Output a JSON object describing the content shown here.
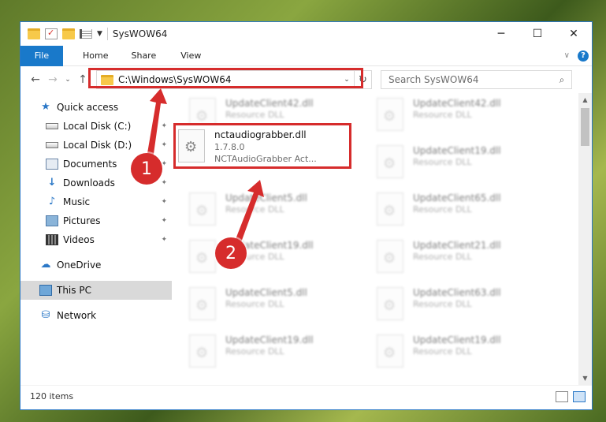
{
  "window": {
    "title": "SysWOW64",
    "minimize": "─",
    "maximize": "☐",
    "close": "✕"
  },
  "ribbon": {
    "tabs": [
      {
        "label": "File"
      },
      {
        "label": "Home"
      },
      {
        "label": "Share"
      },
      {
        "label": "View"
      }
    ],
    "collapse_icon": "chevron-down-icon",
    "help_label": "?"
  },
  "address": {
    "back": "←",
    "forward": "→",
    "recent": "⌄",
    "up": "↑",
    "path": "C:\\Windows\\SysWOW64",
    "dropdown": "⌄",
    "refresh": "↻"
  },
  "search": {
    "placeholder": "Search SysWOW64",
    "icon": "⌕"
  },
  "navpane": {
    "items": [
      {
        "label": "Quick access",
        "icon": "star-icon",
        "glyph": "★",
        "pinned": false
      },
      {
        "label": "Local Disk (C:)",
        "icon": "disk-icon",
        "pinned": true
      },
      {
        "label": "Local Disk (D:)",
        "icon": "disk-icon",
        "pinned": true
      },
      {
        "label": "Documents",
        "icon": "documents-icon",
        "pinned": true
      },
      {
        "label": "Downloads",
        "icon": "downloads-icon",
        "glyph": "↓",
        "pinned": true
      },
      {
        "label": "Music",
        "icon": "music-icon",
        "glyph": "♪",
        "pinned": true
      },
      {
        "label": "Pictures",
        "icon": "pictures-icon",
        "pinned": true
      },
      {
        "label": "Videos",
        "icon": "videos-icon",
        "pinned": true
      },
      {
        "label": "OneDrive",
        "icon": "cloud-icon",
        "glyph": "☁"
      },
      {
        "label": "This PC",
        "icon": "computer-icon"
      },
      {
        "label": "Network",
        "icon": "network-icon",
        "glyph": "⛁"
      }
    ],
    "pin_glyph": "📌"
  },
  "files": {
    "left": [
      {
        "name": "UpdateClient42.dll",
        "type": "Resource DLL"
      },
      {
        "name": "nctaudiograbber.dll",
        "version": "1.7.8.0",
        "type": "NCTAudioGrabber Act..."
      },
      {
        "name": "UpdateClient5.dll",
        "type": "Resource DLL"
      },
      {
        "name": "UpdateClient19.dll",
        "type": "Resource DLL"
      },
      {
        "name": "UpdateClient5.dll",
        "type": "Resource DLL"
      },
      {
        "name": "UpdateClient19.dll",
        "type": "Resource DLL"
      }
    ],
    "right": [
      {
        "name": "UpdateClient42.dll",
        "type": "Resource DLL"
      },
      {
        "name": "UpdateClient19.dll",
        "type": "Resource DLL"
      },
      {
        "name": "UpdateClient65.dll",
        "type": "Resource DLL"
      },
      {
        "name": "UpdateClient21.dll",
        "type": "Resource DLL"
      },
      {
        "name": "UpdateClient63.dll",
        "type": "Resource DLL"
      },
      {
        "name": "UpdateClient19.dll",
        "type": "Resource DLL"
      }
    ]
  },
  "status": {
    "count": "120 items"
  },
  "annotations": {
    "badge1": "1",
    "badge2": "2",
    "color": "#d62c2c"
  }
}
